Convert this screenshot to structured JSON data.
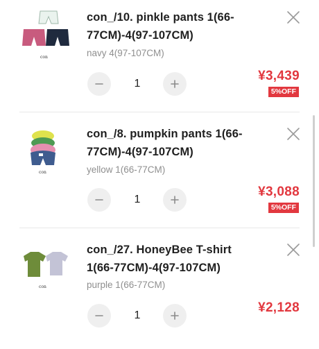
{
  "items": [
    {
      "name": "con_/10. pinkle pants 1(66-77CM)-4(97-107CM)",
      "option": "navy 4(97-107CM)",
      "quantity": "1",
      "price": "¥3,439",
      "discount": "5%OFF",
      "remove_icon": "close-icon",
      "minus_icon": "minus-icon",
      "plus_icon": "plus-icon",
      "thumb_brand": "con",
      "thumb_colors": [
        "#eaf3ee",
        "#c85b7e",
        "#1f2a3e"
      ]
    },
    {
      "name": "con_/8. pumpkin pants 1(66-77CM)-4(97-107CM)",
      "option": "yellow 1(66-77CM)",
      "quantity": "1",
      "price": "¥3,088",
      "discount": "5%OFF",
      "remove_icon": "close-icon",
      "minus_icon": "minus-icon",
      "plus_icon": "plus-icon",
      "thumb_brand": "con",
      "thumb_colors": [
        "#dfe24d",
        "#4e9a53",
        "#e58fb0",
        "#3f5c8f"
      ]
    },
    {
      "name": "con_/27. HoneyBee T-shirt 1(66-77CM)-4(97-107CM)",
      "option": "purple 1(66-77CM)",
      "quantity": "1",
      "price": "¥2,128",
      "remove_icon": "close-icon",
      "minus_icon": "minus-icon",
      "plus_icon": "plus-icon",
      "thumb_brand": "con",
      "thumb_colors": [
        "#6e8c3a",
        "#c3c3d6"
      ]
    }
  ],
  "colors": {
    "price": "#e2383f",
    "badge_bg": "#e2383f",
    "qty_button_bg": "#efefef",
    "divider": "#e8e8e8"
  }
}
